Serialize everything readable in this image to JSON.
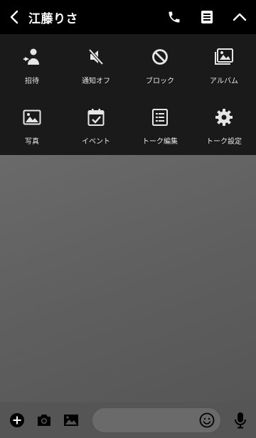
{
  "header": {
    "title": "江藤りさ",
    "back_icon": "chevron-left-icon",
    "call_icon": "phone-icon",
    "notes_icon": "notes-icon",
    "collapse_icon": "chevron-up-icon"
  },
  "menu": {
    "items": [
      {
        "label": "招待",
        "icon": "invite-icon"
      },
      {
        "label": "通知オフ",
        "icon": "mute-icon"
      },
      {
        "label": "ブロック",
        "icon": "block-icon"
      },
      {
        "label": "アルバム",
        "icon": "album-icon"
      },
      {
        "label": "写真",
        "icon": "photo-icon"
      },
      {
        "label": "イベント",
        "icon": "event-icon"
      },
      {
        "label": "トーク編集",
        "icon": "edit-chat-icon"
      },
      {
        "label": "トーク設定",
        "icon": "settings-icon"
      }
    ]
  },
  "input_bar": {
    "placeholder": "",
    "add_icon": "plus-circle-icon",
    "camera_icon": "camera-icon",
    "image_icon": "image-icon",
    "emoji_icon": "emoji-icon",
    "mic_icon": "microphone-icon"
  },
  "colors": {
    "header_bg": "#000000",
    "menu_bg": "#1a1a1a",
    "chat_bg": "#5f5f5f",
    "input_bar_bg": "#555555"
  }
}
